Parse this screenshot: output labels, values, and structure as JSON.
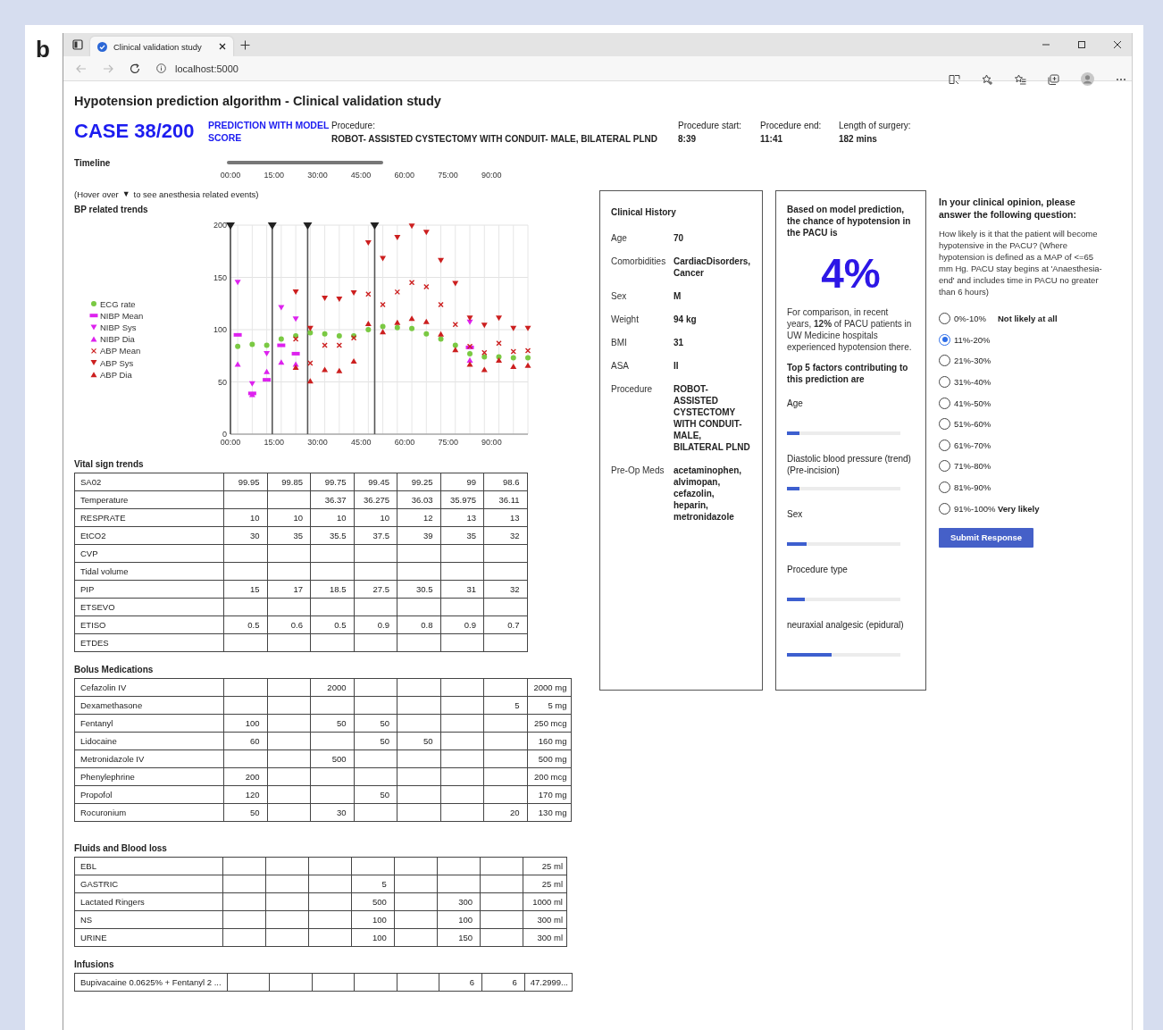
{
  "figure_label": "b",
  "browser": {
    "tab": {
      "title": "Clinical validation study",
      "selected": true
    },
    "address": "localhost:5000"
  },
  "header": {
    "title": "Hypotension prediction algorithm - Clinical validation study",
    "case": "CASE 38/200",
    "mode": "PREDICTION WITH MODEL SCORE",
    "fields": [
      {
        "label": "Procedure:",
        "value": "ROBOT- ASSISTED CYSTECTOMY WITH CONDUIT- MALE, BILATERAL PLND"
      },
      {
        "label": "Procedure start:",
        "value": "8:39"
      },
      {
        "label": "Procedure end:",
        "value": "11:41"
      },
      {
        "label": "Length of surgery:",
        "value": "182 mins"
      }
    ]
  },
  "timeline": {
    "label": "Timeline",
    "ticks": [
      "00:00",
      "15:00",
      "30:00",
      "45:00",
      "60:00",
      "75:00",
      "90:00"
    ]
  },
  "hover_hint": {
    "before": "(Hover over",
    "marker": "▼",
    "after": "to see anesthesia related events)"
  },
  "bp_trends": {
    "title": "BP related trends",
    "chart_data": {
      "type": "scatter",
      "x": [
        2.5,
        7.5,
        12.5,
        17.5,
        22.5,
        27.5,
        32.5,
        37.5,
        42.5,
        47.5,
        52.5,
        57.5,
        62.5,
        67.5,
        72.5,
        77.5,
        82.5,
        87.5,
        92.5,
        97.5,
        102.5
      ],
      "xlim": [
        0,
        102.5
      ],
      "ylim": [
        0,
        200
      ],
      "xticks": [
        {
          "value": 0,
          "label": "00:00"
        },
        {
          "value": 15,
          "label": "15:00"
        },
        {
          "value": 30,
          "label": "30:00"
        },
        {
          "value": 45,
          "label": "45:00"
        },
        {
          "value": 60,
          "label": "60:00"
        },
        {
          "value": 75,
          "label": "75:00"
        },
        {
          "value": 90,
          "label": "90:00"
        }
      ],
      "yticks": [
        0,
        50,
        100,
        150,
        200
      ],
      "grid": true,
      "legend": true,
      "series": [
        {
          "name": "ECG rate",
          "color": "#7ac943",
          "values": [
            84,
            86,
            85,
            91,
            94,
            97,
            96,
            94,
            94,
            100,
            103,
            102,
            101,
            96,
            91,
            85,
            77,
            74,
            74,
            73,
            73
          ]
        },
        {
          "name": "NIBP Mean",
          "color": "#dd22ee",
          "values": [
            95,
            39,
            52,
            85,
            77,
            null,
            null,
            null,
            null,
            null,
            null,
            null,
            null,
            null,
            null,
            null,
            83,
            null,
            null,
            null,
            null
          ]
        },
        {
          "name": "NIBP Sys",
          "color": "#dd22ee",
          "values": [
            145,
            48,
            77,
            121,
            110,
            null,
            null,
            null,
            null,
            null,
            null,
            null,
            null,
            null,
            null,
            null,
            107,
            null,
            null,
            null,
            null
          ]
        },
        {
          "name": "NIBP Dia",
          "color": "#dd22ee",
          "values": [
            67,
            38,
            60,
            69,
            67,
            null,
            null,
            null,
            null,
            null,
            null,
            null,
            null,
            null,
            null,
            null,
            71,
            null,
            null,
            null,
            null
          ]
        },
        {
          "name": "ABP Mean",
          "color": "#cc1f1f",
          "values": [
            null,
            null,
            null,
            null,
            91,
            68,
            85,
            85,
            92,
            134,
            124,
            136,
            145,
            141,
            124,
            105,
            84,
            78,
            87,
            79,
            80
          ]
        },
        {
          "name": "ABP Sys",
          "color": "#cc1f1f",
          "values": [
            null,
            null,
            null,
            null,
            136,
            101,
            130,
            129,
            135,
            183,
            168,
            188,
            199,
            193,
            166,
            144,
            111,
            104,
            111,
            101,
            101
          ]
        },
        {
          "name": "ABP Dia",
          "color": "#cc1f1f",
          "values": [
            null,
            null,
            null,
            null,
            64,
            51,
            62,
            61,
            70,
            106,
            98,
            107,
            111,
            108,
            96,
            81,
            67,
            62,
            71,
            65,
            66
          ]
        }
      ],
      "ref_lines": [
        {
          "axis": "x",
          "value": 0
        },
        {
          "axis": "x",
          "value": 14.4
        },
        {
          "axis": "x",
          "value": 26.6
        },
        {
          "axis": "x",
          "value": 49.7
        }
      ]
    }
  },
  "tables": [
    {
      "title": "Vital sign trends",
      "rows": [
        {
          "name": "SA02",
          "cells": [
            "99.95",
            "99.85",
            "99.75",
            "99.45",
            "99.25",
            "99",
            "98.6"
          ]
        },
        {
          "name": "Temperature",
          "cells": [
            null,
            null,
            "36.37",
            "36.275",
            "36.03",
            "35.975",
            "36.11"
          ]
        },
        {
          "name": "RESPRATE",
          "cells": [
            "10",
            "10",
            "10",
            "10",
            "12",
            "13",
            "13"
          ]
        },
        {
          "name": "EtCO2",
          "cells": [
            "30",
            "35",
            "35.5",
            "37.5",
            "39",
            "35",
            "32"
          ]
        },
        {
          "name": "CVP",
          "cells": [
            null,
            null,
            null,
            null,
            null,
            null,
            null
          ]
        },
        {
          "name": "Tidal volume",
          "cells": [
            null,
            null,
            null,
            null,
            null,
            null,
            null
          ]
        },
        {
          "name": "PIP",
          "cells": [
            "15",
            "17",
            "18.5",
            "27.5",
            "30.5",
            "31",
            "32"
          ]
        },
        {
          "name": "ETSEVO",
          "cells": [
            null,
            null,
            null,
            null,
            null,
            null,
            null
          ]
        },
        {
          "name": "ETISO",
          "cells": [
            "0.5",
            "0.6",
            "0.5",
            "0.9",
            "0.8",
            "0.9",
            "0.7"
          ]
        },
        {
          "name": "ETDES",
          "cells": [
            null,
            null,
            null,
            null,
            null,
            null,
            null
          ]
        }
      ]
    },
    {
      "title": "Bolus Medications",
      "rows": [
        {
          "name": "Cefazolin IV",
          "cells": [
            null,
            null,
            "2000",
            null,
            null,
            null,
            null
          ],
          "total": "2000 mg"
        },
        {
          "name": "Dexamethasone",
          "cells": [
            null,
            null,
            null,
            null,
            null,
            null,
            "5"
          ],
          "total": "5 mg"
        },
        {
          "name": "Fentanyl",
          "cells": [
            "100",
            null,
            "50",
            "50",
            null,
            null,
            null
          ],
          "total": "250 mcg"
        },
        {
          "name": "Lidocaine",
          "cells": [
            "60",
            null,
            null,
            "50",
            "50",
            null,
            null
          ],
          "total": "160 mg"
        },
        {
          "name": "Metronidazole IV",
          "cells": [
            null,
            null,
            "500",
            null,
            null,
            null,
            null
          ],
          "total": "500 mg"
        },
        {
          "name": "Phenylephrine",
          "cells": [
            "200",
            null,
            null,
            null,
            null,
            null,
            null
          ],
          "total": "200 mcg"
        },
        {
          "name": "Propofol",
          "cells": [
            "120",
            null,
            null,
            "50",
            null,
            null,
            null
          ],
          "total": "170 mg"
        },
        {
          "name": "Rocuronium",
          "cells": [
            "50",
            null,
            "30",
            null,
            null,
            null,
            "20"
          ],
          "total": "130 mg"
        }
      ]
    },
    {
      "title": "Fluids and Blood loss",
      "rows": [
        {
          "name": "EBL",
          "cells": [
            null,
            null,
            null,
            null,
            null,
            null,
            null
          ],
          "total": "25 ml"
        },
        {
          "name": "GASTRIC",
          "cells": [
            null,
            null,
            null,
            "5",
            null,
            null,
            null
          ],
          "total": "25 ml"
        },
        {
          "name": "Lactated Ringers",
          "cells": [
            null,
            null,
            null,
            "500",
            null,
            "300",
            null
          ],
          "total": "1000 ml"
        },
        {
          "name": "NS",
          "cells": [
            null,
            null,
            null,
            "100",
            null,
            "100",
            null
          ],
          "total": "300 ml"
        },
        {
          "name": "URINE",
          "cells": [
            null,
            null,
            null,
            "100",
            null,
            "150",
            null
          ],
          "total": "300 ml"
        }
      ]
    },
    {
      "title": "Infusions",
      "rows": [
        {
          "name": "Bupivacaine 0.0625% + Fentanyl 2 ...",
          "cells": [
            null,
            null,
            null,
            null,
            null,
            "6",
            "6"
          ],
          "total": "47.2999..."
        }
      ]
    }
  ],
  "clinical_history": {
    "title": "Clinical History",
    "rows": [
      {
        "label": "Age",
        "value": "70"
      },
      {
        "label": "Comorbidities",
        "value": "CardiacDisorders, Cancer"
      },
      {
        "label": "Sex",
        "value": "M"
      },
      {
        "label": "Weight",
        "value": "94 kg"
      },
      {
        "label": "BMI",
        "value": "31"
      },
      {
        "label": "ASA",
        "value": "II"
      },
      {
        "label": "Procedure",
        "value": "ROBOT- ASSISTED CYSTECTOMY WITH CONDUIT- MALE, BILATERAL PLND"
      },
      {
        "label": "Pre-Op Meds",
        "value": "acetaminophen, alvimopan, cefazolin, heparin, metronidazole"
      }
    ]
  },
  "prediction": {
    "intro": "Based on model prediction, the chance of hypotension in the PACU is",
    "percent": "4%",
    "comparison": "For comparison, in recent years, **12%** of PACU patients in UW Medicine hospitals experienced hypotension there.",
    "factors_title": "Top 5 factors contributing to this prediction are",
    "factors": [
      {
        "label": "Age",
        "level": 0.11
      },
      {
        "label": "Diastolic blood pressure (trend) (Pre-incision)",
        "level": 0.11
      },
      {
        "label": "Sex",
        "level": 0.17
      },
      {
        "label": "Procedure type",
        "level": 0.16
      },
      {
        "label": "neuraxial analgesic (epidural)",
        "level": 0.39
      }
    ]
  },
  "question": {
    "title": "In your clinical opinion, please answer the following question:",
    "text": "How likely is it that the patient will become hypotensive in the PACU? (Where hypotension is defined as a MAP of <=65 mm Hg. PACU stay begins at 'Anaesthesia-end' and includes time in PACU no greater than 6 hours)",
    "options": [
      {
        "label": "0%-10%",
        "note": "Not likely at all",
        "selected": false
      },
      {
        "label": "11%-20%",
        "selected": true
      },
      {
        "label": "21%-30%",
        "selected": false
      },
      {
        "label": "31%-40%",
        "selected": false
      },
      {
        "label": "41%-50%",
        "selected": false
      },
      {
        "label": "51%-60%",
        "selected": false
      },
      {
        "label": "61%-70%",
        "selected": false
      },
      {
        "label": "71%-80%",
        "selected": false
      },
      {
        "label": "81%-90%",
        "selected": false
      },
      {
        "label": "91%-100%",
        "note": "Very likely",
        "selected": false
      }
    ],
    "submit": "Submit Response"
  }
}
